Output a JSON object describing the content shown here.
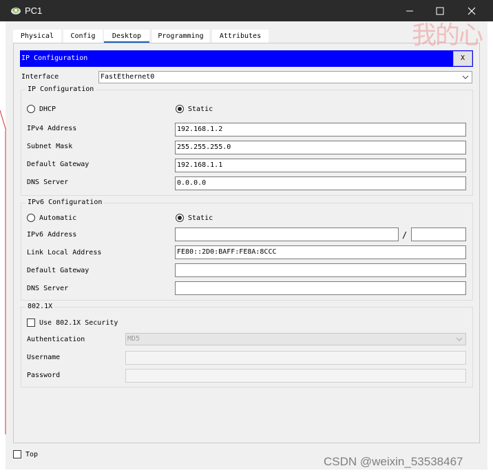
{
  "window": {
    "title": "PC1",
    "minimize": "—",
    "maximize": "☐",
    "close": "✕",
    "icon": "packet-tracer-pc-icon"
  },
  "tabs": [
    {
      "label": "Physical",
      "active": false
    },
    {
      "label": "Config",
      "active": false
    },
    {
      "label": "Desktop",
      "active": true
    },
    {
      "label": "Programming",
      "active": false
    },
    {
      "label": "Attributes",
      "active": false
    }
  ],
  "ip_config": {
    "header": "IP Configuration",
    "close_label": "X",
    "interface_label": "Interface",
    "interface_value": "FastEthernet0",
    "ipv4": {
      "group_title": "IP Configuration",
      "dhcp_label": "DHCP",
      "static_label": "Static",
      "mode": "Static",
      "ipv4_address_label": "IPv4 Address",
      "ipv4_address": "192.168.1.2",
      "subnet_mask_label": "Subnet Mask",
      "subnet_mask": "255.255.255.0",
      "gateway_label": "Default Gateway",
      "gateway": "192.168.1.1",
      "dns_label": "DNS Server",
      "dns": "0.0.0.0"
    },
    "ipv6": {
      "group_title": "IPv6 Configuration",
      "automatic_label": "Automatic",
      "static_label": "Static",
      "mode": "Static",
      "ipv6_address_label": "IPv6 Address",
      "ipv6_address": "",
      "prefix_separator": "/",
      "prefix": "",
      "link_local_label": "Link Local Address",
      "link_local": "FE80::2D0:BAFF:FE8A:8CCC",
      "gateway_label": "Default Gateway",
      "gateway": "",
      "dns_label": "DNS Server",
      "dns": ""
    },
    "dot1x": {
      "group_title": "802.1X",
      "use_label": "Use 802.1X Security",
      "use_checked": false,
      "auth_label": "Authentication",
      "auth_value": "MD5",
      "username_label": "Username",
      "username": "",
      "password_label": "Password",
      "password": ""
    }
  },
  "footer": {
    "top_label": "Top",
    "top_checked": false
  },
  "watermarks": {
    "chinese": "我的心",
    "csdn": "CSDN @weixin_53538467"
  }
}
